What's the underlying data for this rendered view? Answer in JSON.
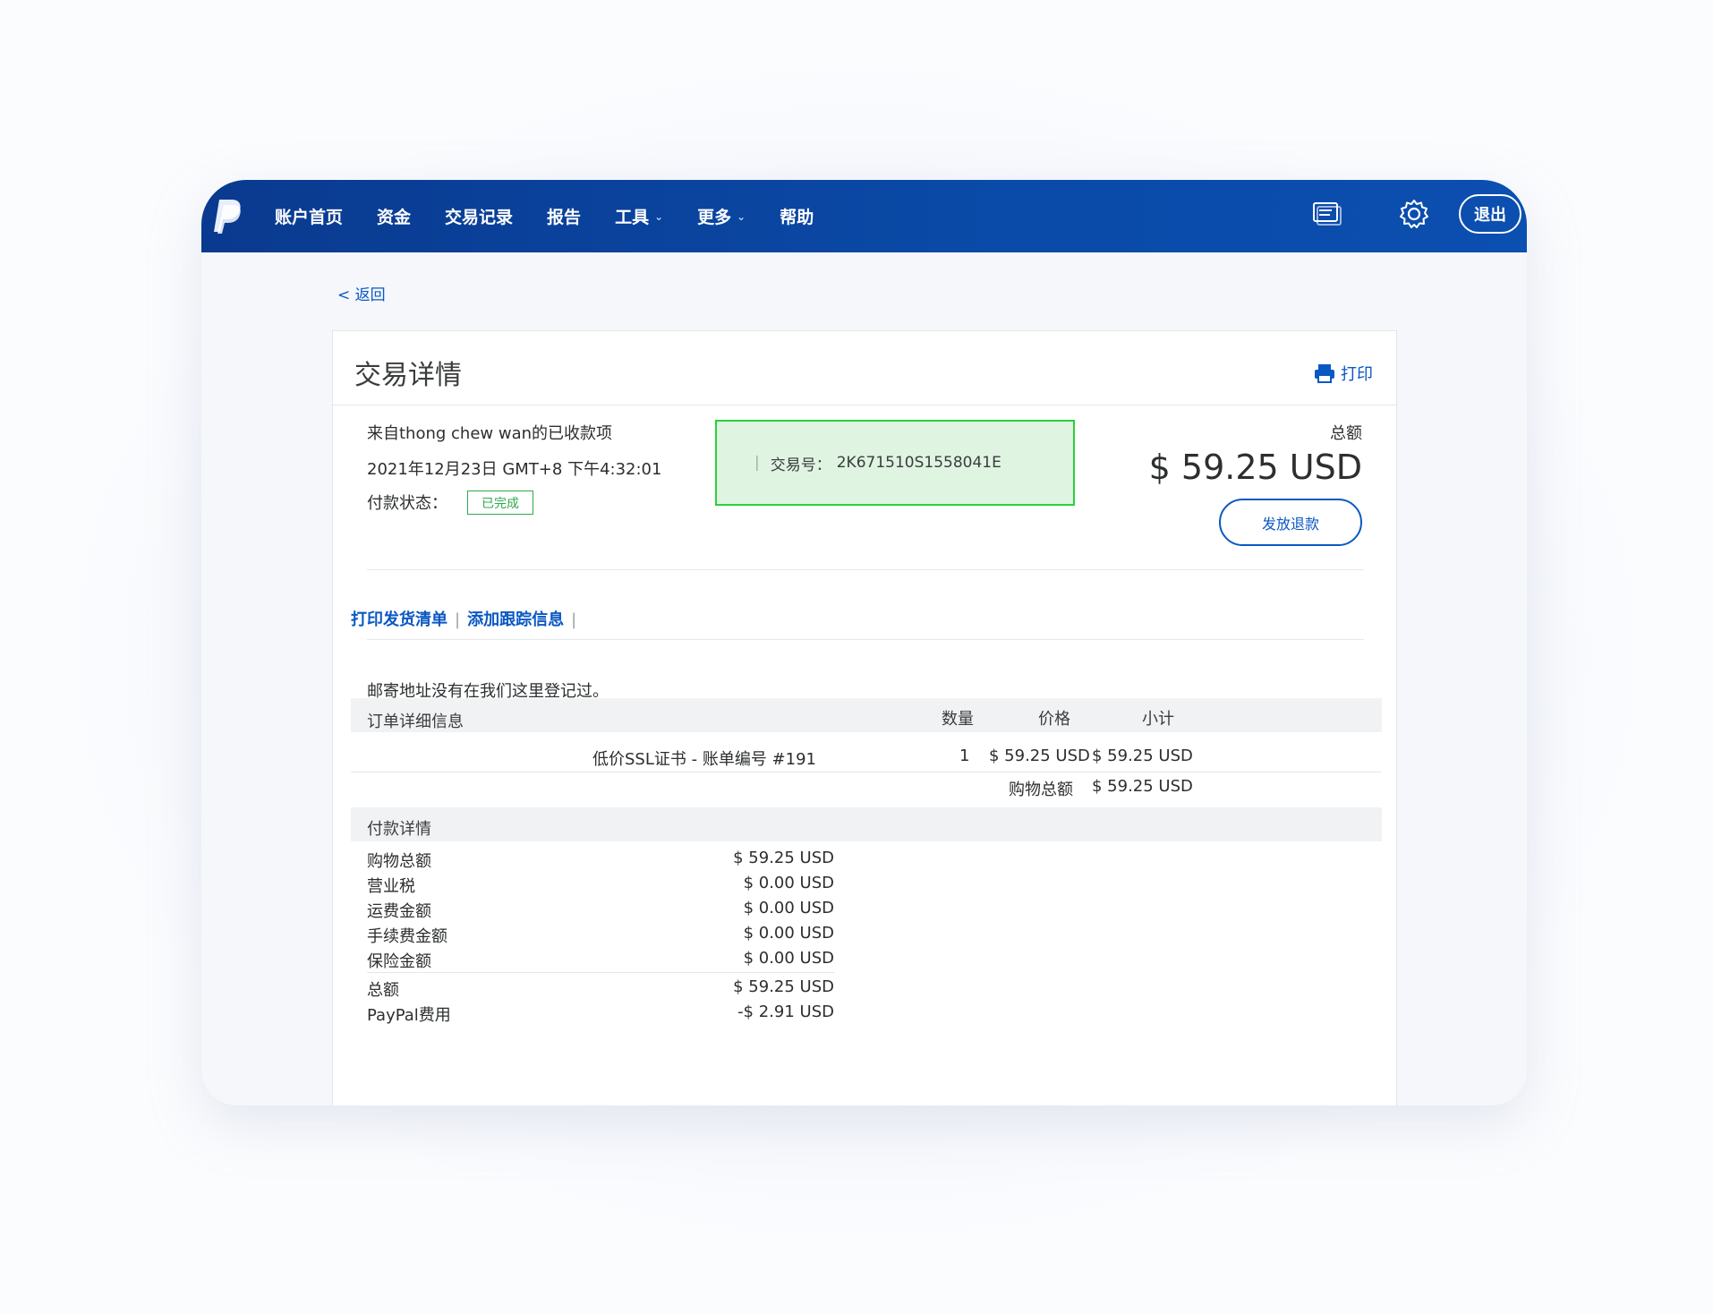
{
  "nav": {
    "items": [
      {
        "label": "账户首页"
      },
      {
        "label": "资金"
      },
      {
        "label": "交易记录"
      },
      {
        "label": "报告"
      },
      {
        "label": "工具",
        "has_dropdown": true
      },
      {
        "label": "更多",
        "has_dropdown": true
      },
      {
        "label": "帮助"
      }
    ],
    "logout_label": "退出",
    "icons": [
      "paypal-logo",
      "message-icon",
      "gear-icon"
    ]
  },
  "back_label": "< 返回",
  "card": {
    "title": "交易详情",
    "print_label": "打印",
    "from_text": "来自thong chew wan的已收款项",
    "date_text": "2021年12月23日 GMT+8 下午4:32:01",
    "status_label": "付款状态：",
    "status_value": "已完成",
    "txid_label": "交易号：",
    "txid_value": "2K671510S1558041E",
    "total_label": "总额",
    "total_amount": "$ 59.25 USD",
    "refund_button": "发放退款"
  },
  "actions": {
    "print_packing": "打印发货清单",
    "add_tracking": "添加跟踪信息"
  },
  "address_note": "邮寄地址没有在我们这里登记过。",
  "order": {
    "header": {
      "details": "订单详细信息",
      "qty": "数量",
      "price": "价格",
      "subtotal": "小计"
    },
    "rows": [
      {
        "name": "低价SSL证书 - 账单编号 #191",
        "qty": "1",
        "price": "$ 59.25 USD",
        "subtotal": "$ 59.25 USD"
      }
    ],
    "cart_total_label": "购物总额",
    "cart_total_value": "$ 59.25 USD"
  },
  "payment": {
    "header": "付款详情",
    "rows": [
      {
        "label": "购物总额",
        "value": "$ 59.25 USD"
      },
      {
        "label": "营业税",
        "value": "$ 0.00 USD"
      },
      {
        "label": "运费金额",
        "value": "$ 0.00 USD"
      },
      {
        "label": "手续费金额",
        "value": "$ 0.00 USD"
      },
      {
        "label": "保险金额",
        "value": "$ 0.00 USD"
      },
      {
        "label": "总额",
        "value": "$ 59.25 USD"
      },
      {
        "label": "PayPal费用",
        "value": "-$ 2.91 USD"
      }
    ]
  },
  "colors": {
    "topbar": "#0a4aa8",
    "link": "#0a58c4",
    "status_green": "#2fa84f",
    "highlight_fill": "#dff5e1",
    "highlight_border": "#2bd13b"
  }
}
